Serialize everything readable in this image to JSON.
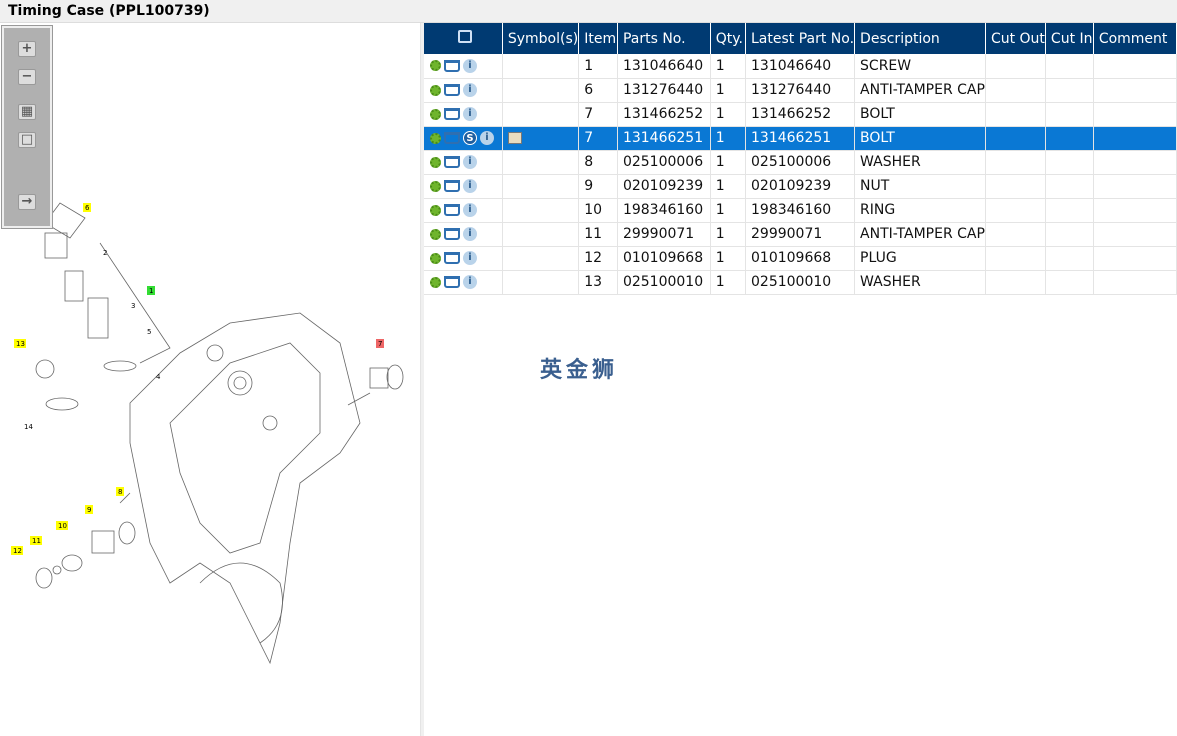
{
  "window": {
    "title": "Timing Case (PPL100739)"
  },
  "toolbar": {
    "buttons": [
      "zoom-in",
      "zoom-out",
      "fit-all",
      "fit-window",
      "toggle-list"
    ]
  },
  "diagram": {
    "callouts": [
      {
        "label": "6",
        "color": "#ffff00"
      },
      {
        "label": "2",
        "color": ""
      },
      {
        "label": "1",
        "color": "#33dd33"
      },
      {
        "label": "3",
        "color": ""
      },
      {
        "label": "5",
        "color": ""
      },
      {
        "label": "4",
        "color": ""
      },
      {
        "label": "13",
        "color": "#ffff00"
      },
      {
        "label": "14",
        "color": ""
      },
      {
        "label": "7",
        "color": "#ee6666"
      },
      {
        "label": "8",
        "color": "#ffff00"
      },
      {
        "label": "9",
        "color": "#ffff00"
      },
      {
        "label": "10",
        "color": "#ffff00"
      },
      {
        "label": "11",
        "color": "#ffff00"
      },
      {
        "label": "12",
        "color": "#ffff00"
      }
    ]
  },
  "table": {
    "headers": [
      "",
      "Symbol(s)",
      "Item",
      "Parts No.",
      "Qty.",
      "Latest Part No.",
      "Description",
      "Cut Out",
      "Cut In",
      "Comment"
    ],
    "rows": [
      {
        "item": "1",
        "part": "131046640",
        "qty": "1",
        "latest": "131046640",
        "desc": "SCREW"
      },
      {
        "item": "6",
        "part": "131276440",
        "qty": "1",
        "latest": "131276440",
        "desc": "ANTI-TAMPER CAP"
      },
      {
        "item": "7",
        "part": "131466252",
        "qty": "1",
        "latest": "131466252",
        "desc": "BOLT"
      },
      {
        "item": "7",
        "part": "131466251",
        "qty": "1",
        "latest": "131466251",
        "desc": "BOLT",
        "selected": true
      },
      {
        "item": "8",
        "part": "025100006",
        "qty": "1",
        "latest": "025100006",
        "desc": "WASHER"
      },
      {
        "item": "9",
        "part": "020109239",
        "qty": "1",
        "latest": "020109239",
        "desc": "NUT"
      },
      {
        "item": "10",
        "part": "198346160",
        "qty": "1",
        "latest": "198346160",
        "desc": "RING"
      },
      {
        "item": "11",
        "part": "29990071",
        "qty": "1",
        "latest": "29990071",
        "desc": "ANTI-TAMPER CAP"
      },
      {
        "item": "12",
        "part": "010109668",
        "qty": "1",
        "latest": "010109668",
        "desc": "PLUG"
      },
      {
        "item": "13",
        "part": "025100010",
        "qty": "1",
        "latest": "025100010",
        "desc": "WASHER"
      }
    ]
  },
  "watermark": "英金狮",
  "icons": {
    "s_badge": "S",
    "info": "i"
  }
}
